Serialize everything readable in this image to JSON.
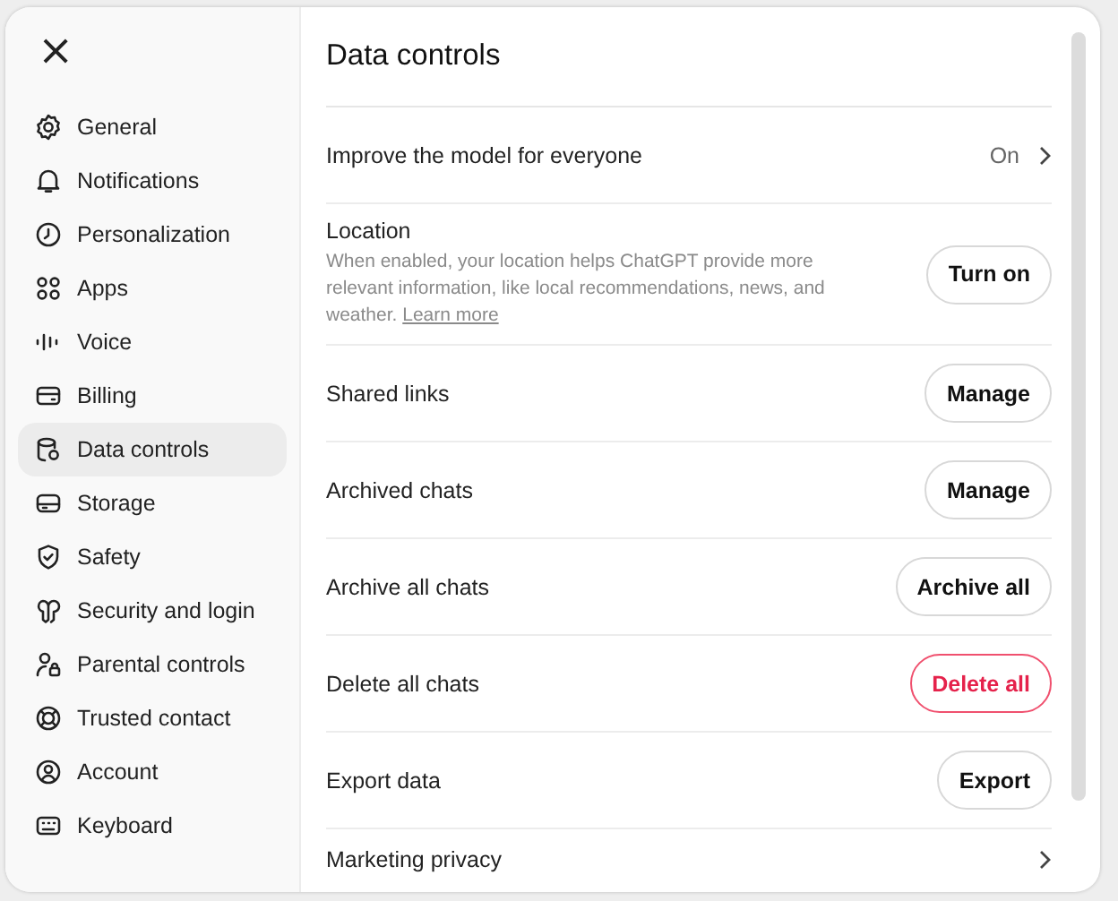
{
  "close_label": "×",
  "sidebar": {
    "items": [
      {
        "label": "General",
        "selected": false
      },
      {
        "label": "Notifications",
        "selected": false
      },
      {
        "label": "Personalization",
        "selected": false
      },
      {
        "label": "Apps",
        "selected": false
      },
      {
        "label": "Voice",
        "selected": false
      },
      {
        "label": "Billing",
        "selected": false
      },
      {
        "label": "Data controls",
        "selected": true
      },
      {
        "label": "Storage",
        "selected": false
      },
      {
        "label": "Safety",
        "selected": false
      },
      {
        "label": "Security and login",
        "selected": false
      },
      {
        "label": "Parental controls",
        "selected": false
      },
      {
        "label": "Trusted contact",
        "selected": false
      },
      {
        "label": "Account",
        "selected": false
      },
      {
        "label": "Keyboard",
        "selected": false
      }
    ]
  },
  "page": {
    "title": "Data controls",
    "rows": [
      {
        "kind": "nav",
        "label": "Improve the model for everyone",
        "value": "On"
      },
      {
        "kind": "action",
        "label": "Location",
        "description": "When enabled, your location helps ChatGPT provide more relevant information, like local recommendations, news, and weather.",
        "link": "Learn more",
        "button": {
          "label": "Turn on",
          "danger": false
        }
      },
      {
        "kind": "action",
        "label": "Shared links",
        "button": {
          "label": "Manage",
          "danger": false
        }
      },
      {
        "kind": "action",
        "label": "Archived chats",
        "button": {
          "label": "Manage",
          "danger": false
        }
      },
      {
        "kind": "action",
        "label": "Archive all chats",
        "button": {
          "label": "Archive all",
          "danger": false
        }
      },
      {
        "kind": "action",
        "label": "Delete all chats",
        "button": {
          "label": "Delete all",
          "danger": true
        }
      },
      {
        "kind": "action",
        "label": "Export data",
        "button": {
          "label": "Export",
          "danger": false
        }
      },
      {
        "kind": "nav",
        "label": "Marketing privacy"
      }
    ]
  }
}
